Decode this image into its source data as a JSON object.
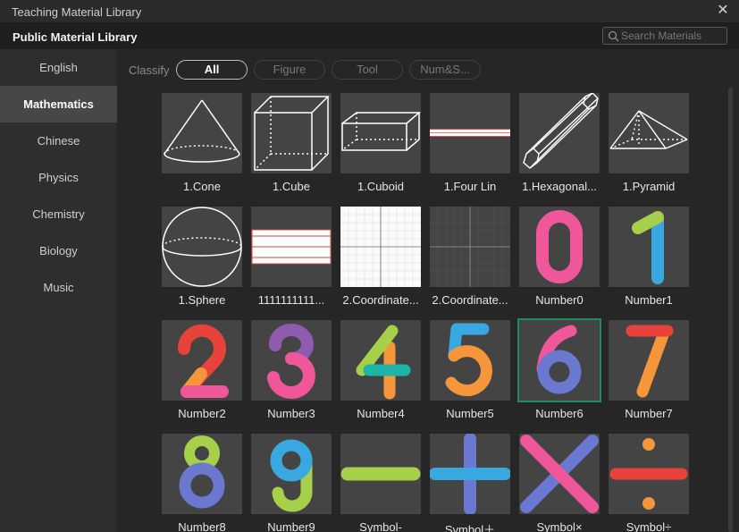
{
  "window": {
    "title": "Teaching Material Library",
    "close_glyph": "✕"
  },
  "library": {
    "title": "Public Material Library"
  },
  "search": {
    "placeholder": "Search Materials",
    "value": ""
  },
  "sidebar": {
    "items": [
      {
        "label": "English"
      },
      {
        "label": "Mathematics",
        "active": true
      },
      {
        "label": "Chinese"
      },
      {
        "label": "Physics"
      },
      {
        "label": "Chemistry"
      },
      {
        "label": "Biology"
      },
      {
        "label": "Music"
      }
    ]
  },
  "filters": {
    "label": "Classify",
    "chips": [
      {
        "label": "All",
        "active": true
      },
      {
        "label": "Figure"
      },
      {
        "label": "Tool"
      },
      {
        "label": "Num&S..."
      }
    ]
  },
  "materials": [
    {
      "label": "1.Cone",
      "icon": "cone-icon"
    },
    {
      "label": "1.Cube",
      "icon": "cube-icon"
    },
    {
      "label": "1.Cuboid",
      "icon": "cuboid-icon"
    },
    {
      "label": "1.Four Lin",
      "icon": "four-line-icon"
    },
    {
      "label": "1.Hexagonal...",
      "icon": "hexagonal-prism-icon"
    },
    {
      "label": "1.Pyramid",
      "icon": "pyramid-icon"
    },
    {
      "label": "1.Sphere",
      "icon": "sphere-icon"
    },
    {
      "label": "1111111111...",
      "icon": "lined-paper-icon"
    },
    {
      "label": "2.Coordinate...",
      "icon": "coordinate-grid-light-icon"
    },
    {
      "label": "2.Coordinate...",
      "icon": "coordinate-grid-dark-icon"
    },
    {
      "label": "Number0",
      "icon": "number-0-icon"
    },
    {
      "label": "Number1",
      "icon": "number-1-icon"
    },
    {
      "label": "Number2",
      "icon": "number-2-icon"
    },
    {
      "label": "Number3",
      "icon": "number-3-icon"
    },
    {
      "label": "Number4",
      "icon": "number-4-icon"
    },
    {
      "label": "Number5",
      "icon": "number-5-icon"
    },
    {
      "label": "Number6",
      "icon": "number-6-icon",
      "selected": true
    },
    {
      "label": "Number7",
      "icon": "number-7-icon"
    },
    {
      "label": "Number8",
      "icon": "number-8-icon"
    },
    {
      "label": "Number9",
      "icon": "number-9-icon"
    },
    {
      "label": "Symbol-",
      "icon": "minus-symbol-icon"
    },
    {
      "label": "Symbol＋",
      "icon": "plus-symbol-icon"
    },
    {
      "label": "Symbol×",
      "icon": "times-symbol-icon"
    },
    {
      "label": "Symbol÷",
      "icon": "divide-symbol-icon"
    }
  ],
  "colors": {
    "accent_selected": "#1c8e5b",
    "pink": "#f0579a",
    "green": "#a6cf4a",
    "blue": "#3aa8e0",
    "red": "#e8433b",
    "orange": "#f5963a",
    "purple": "#8f5bb0",
    "indigo": "#6a78cf",
    "teal": "#1cb5a8"
  }
}
